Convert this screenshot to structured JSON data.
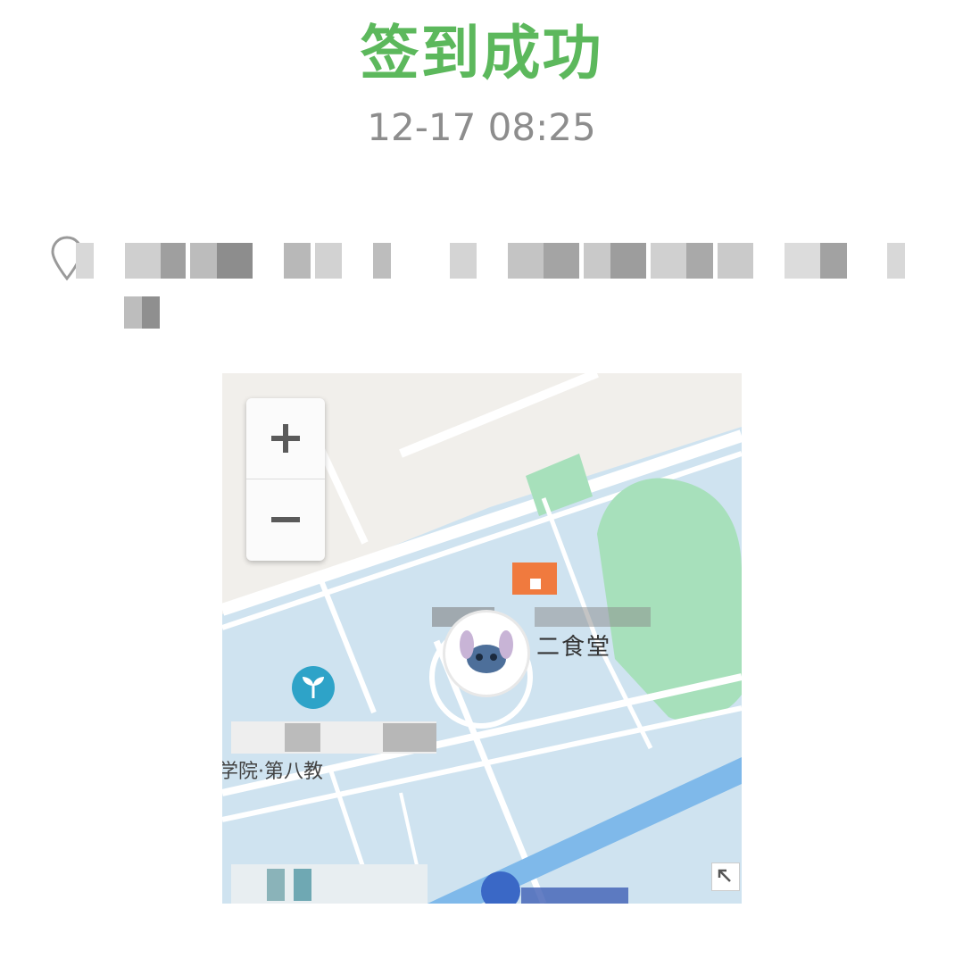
{
  "checkin": {
    "status_title": "签到成功",
    "time": "12-17 08:25"
  },
  "location": {
    "icon": "location-pin-icon",
    "address_redacted": true
  },
  "map": {
    "zoom_in_label": "+",
    "zoom_out_label": "−",
    "poi_cafeteria_label": "二食堂",
    "poi_school_label": "学院·第八教",
    "icons": [
      "zoom-in-icon",
      "zoom-out-icon",
      "user-avatar-icon",
      "park-leaf-icon",
      "hospital-icon",
      "expand-map-icon"
    ],
    "colors": {
      "campus_area": "#cfe3f0",
      "field": "#a7e0bb",
      "road": "#ffffff",
      "river": "#7fb9ea",
      "poi_marker": "#f07a3e"
    }
  },
  "theme": {
    "success_color": "#5cb85c",
    "muted_text": "#8d8d8d"
  }
}
